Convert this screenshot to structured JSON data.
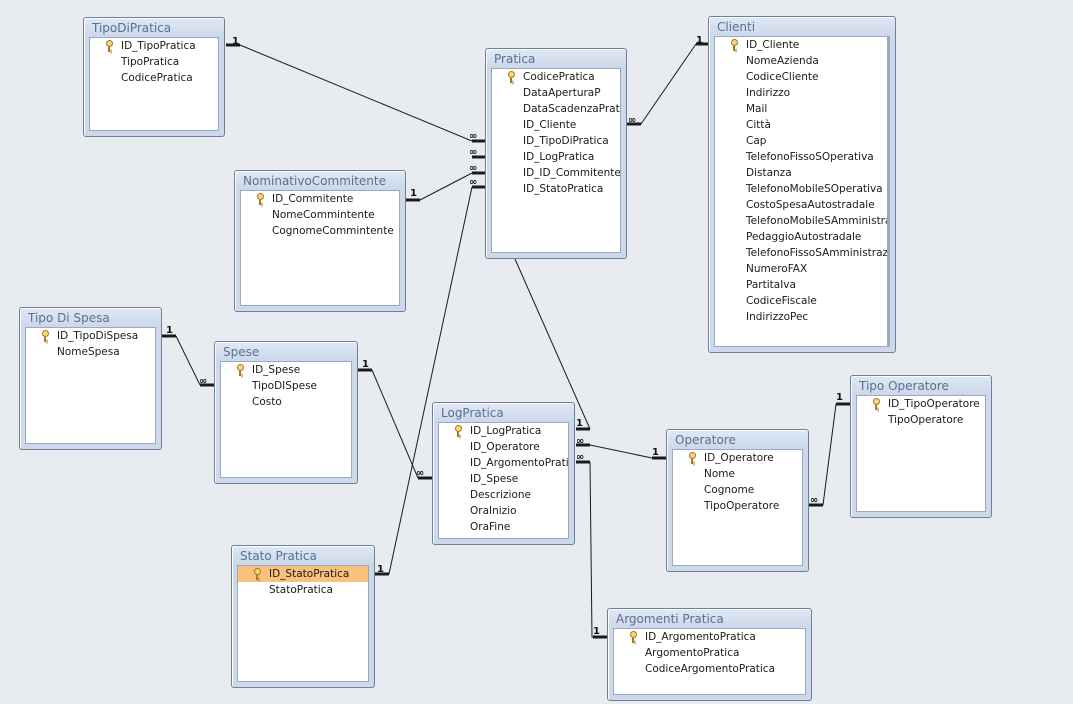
{
  "tables": {
    "tipo_di_pratica": {
      "title": "TipoDiPratica",
      "fields": [
        "ID_TipoPratica",
        "TipoPratica",
        "CodicePratica"
      ]
    },
    "pratica": {
      "title": "Pratica",
      "fields": [
        "CodicePratica",
        "DataAperturaP",
        "DataScadenzaPratica",
        "ID_Cliente",
        "ID_TipoDiPratica",
        "ID_LogPratica",
        "ID_ID_Commitente",
        "ID_StatoPratica"
      ]
    },
    "clienti": {
      "title": "Clienti",
      "fields": [
        "ID_Cliente",
        "NomeAzienda",
        "CodiceCliente",
        "Indirizzo",
        "Mail",
        "Città",
        "Cap",
        "TelefonoFissoSOperativa",
        "Distanza",
        "TelefonoMobileSOperativa",
        "CostoSpesaAutostradale",
        "TelefonoMobileSAmministrazi",
        "PedaggioAutostradale",
        "TelefonoFissoSAmministrazior",
        "NumeroFAX",
        "PartitaIva",
        "CodiceFiscale",
        "IndirizzoPec"
      ]
    },
    "nominativo_commitente": {
      "title": "NominativoCommitente",
      "fields": [
        "ID_Commitente",
        "NomeCommintente",
        "CognomeCommintente"
      ]
    },
    "tipo_di_spesa": {
      "title": "Tipo Di Spesa",
      "fields": [
        "ID_TipoDiSpesa",
        "NomeSpesa"
      ]
    },
    "spese": {
      "title": "Spese",
      "fields": [
        "ID_Spese",
        "TipoDISpese",
        "Costo"
      ]
    },
    "log_pratica": {
      "title": "LogPratica",
      "fields": [
        "ID_LogPratica",
        "ID_Operatore",
        "ID_ArgomentoPratica",
        "ID_Spese",
        "Descrizione",
        "OraInizio",
        "OraFine"
      ]
    },
    "operatore": {
      "title": "Operatore",
      "fields": [
        "ID_Operatore",
        "Nome",
        "Cognome",
        "TipoOperatore"
      ]
    },
    "tipo_operatore": {
      "title": "Tipo Operatore",
      "fields": [
        "ID_TipoOperatore",
        "TipoOperatore"
      ]
    },
    "stato_pratica": {
      "title": "Stato Pratica",
      "fields": [
        "ID_StatoPratica",
        "StatoPratica"
      ]
    },
    "argomenti_pratica": {
      "title": "Argomenti Pratica",
      "fields": [
        "ID_ArgomentoPratica",
        "ArgomentoPratica",
        "CodiceArgomentoPratica"
      ]
    }
  },
  "cardinality": {
    "one": "1",
    "many": "∞"
  },
  "colors": {
    "background": "#e8ecf1",
    "selected_field": "#f9c17c",
    "line": "#1a1a1a"
  }
}
